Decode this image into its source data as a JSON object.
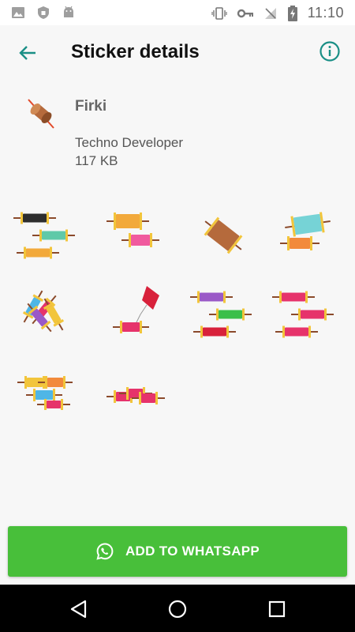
{
  "status_bar": {
    "time": "11:10",
    "left_icons": [
      "image-icon",
      "shield-icon",
      "android-icon"
    ],
    "right_icons": [
      "vibrate-icon",
      "key-icon",
      "no-signal-icon",
      "battery-charging-icon"
    ]
  },
  "app_bar": {
    "title": "Sticker details",
    "back_icon": "arrow-back-icon",
    "info_icon": "info-icon"
  },
  "pack": {
    "name": "Firki",
    "publisher": "Techno Developer",
    "size": "117 KB"
  },
  "stickers": [
    {
      "name": "sticker-1",
      "style": "three-spools",
      "colors": [
        "#2d2d2d",
        "#5fc9a8",
        "#f2a93b"
      ]
    },
    {
      "name": "sticker-2",
      "style": "two-spools",
      "colors": [
        "#f2a93b",
        "#f05a9e"
      ]
    },
    {
      "name": "sticker-3",
      "style": "big-spool",
      "colors": [
        "#b56a3c"
      ]
    },
    {
      "name": "sticker-4",
      "style": "two-spools-tilt",
      "colors": [
        "#76d3d6",
        "#f28a3c"
      ]
    },
    {
      "name": "sticker-5",
      "style": "bunch",
      "colors": [
        "#4fb6e6",
        "#e6336b",
        "#f2c53b",
        "#9a59c7"
      ]
    },
    {
      "name": "sticker-6",
      "style": "kite-spool",
      "colors": [
        "#e6336b",
        "#d8213b"
      ]
    },
    {
      "name": "sticker-7",
      "style": "three-spools",
      "colors": [
        "#9a59c7",
        "#3bbf4a",
        "#d8213b"
      ]
    },
    {
      "name": "sticker-8",
      "style": "three-spools",
      "colors": [
        "#e6336b",
        "#e6336b",
        "#e6336b"
      ]
    },
    {
      "name": "sticker-9",
      "style": "stack",
      "colors": [
        "#f2c53b",
        "#f28a3c",
        "#4fb6e6",
        "#e6336b"
      ]
    },
    {
      "name": "sticker-10",
      "style": "row",
      "colors": [
        "#e6336b",
        "#e6336b",
        "#e6336b"
      ]
    }
  ],
  "add_button": {
    "label": "ADD TO WHATSAPP",
    "color": "#48bf3a"
  },
  "nav_bar": {
    "icons": [
      "back-triangle-icon",
      "home-circle-icon",
      "recents-square-icon"
    ]
  },
  "colors": {
    "accent": "#1a8f86",
    "background": "#f7f7f7"
  }
}
